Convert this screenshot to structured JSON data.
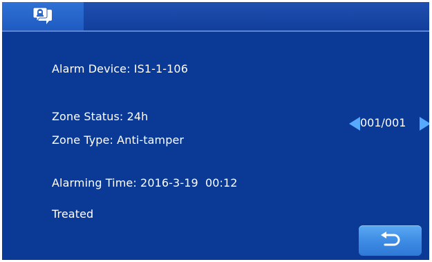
{
  "header": {
    "tabs": [
      {
        "icon": "message-alarm-icon",
        "active": true
      }
    ]
  },
  "alarm": {
    "device_label": "Alarm Device:",
    "device_value": "IS1-1-106",
    "zone_status_label": "Zone Status:",
    "zone_status_value": "24h",
    "zone_type_label": "Zone Type:",
    "zone_type_value": "Anti-tamper",
    "time_label": "Alarming Time:",
    "time_date": "2016-3-19",
    "time_clock": "00:12",
    "state": "Treated"
  },
  "pager": {
    "text": "001/001",
    "prev_icon": "triangle-left-icon",
    "next_icon": "triangle-right-icon"
  },
  "back_button": {
    "icon": "return-arrow-icon"
  },
  "colors": {
    "background": "#0b3a96",
    "header": "#1a4aa8",
    "active_tab": "#2a6ad0",
    "accent_arrow": "#56a9ff",
    "button": "#4a98ea",
    "text": "#ffffff"
  }
}
